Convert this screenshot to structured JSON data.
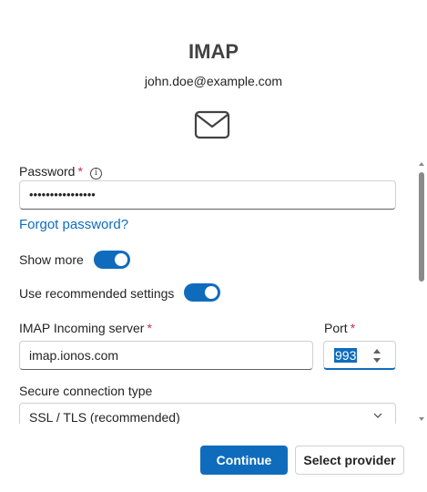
{
  "header": {
    "title": "IMAP",
    "email": "john.doe@example.com"
  },
  "icons": {
    "mail": "mail-envelope-icon",
    "info": "info-icon",
    "chevron": "chevron-down-icon"
  },
  "colors": {
    "accent": "#0f6cbd",
    "required": "#c4314b",
    "text": "#242424",
    "border": "#d1d1d1"
  },
  "form": {
    "password": {
      "label": "Password",
      "required_mark": "*",
      "info_glyph": "i",
      "value": "••••••••••••••••"
    },
    "forgot_password": "Forgot password?",
    "show_more": {
      "label": "Show more",
      "on": true
    },
    "use_recommended": {
      "label": "Use recommended settings",
      "on": true
    },
    "incoming_server": {
      "label": "IMAP Incoming server",
      "required_mark": "*",
      "value": "imap.ionos.com"
    },
    "port": {
      "label": "Port",
      "required_mark": "*",
      "value": "993"
    },
    "secure_connection": {
      "label": "Secure connection type",
      "value": "SSL / TLS (recommended)"
    }
  },
  "footer": {
    "continue_label": "Continue",
    "select_provider_label": "Select provider"
  }
}
